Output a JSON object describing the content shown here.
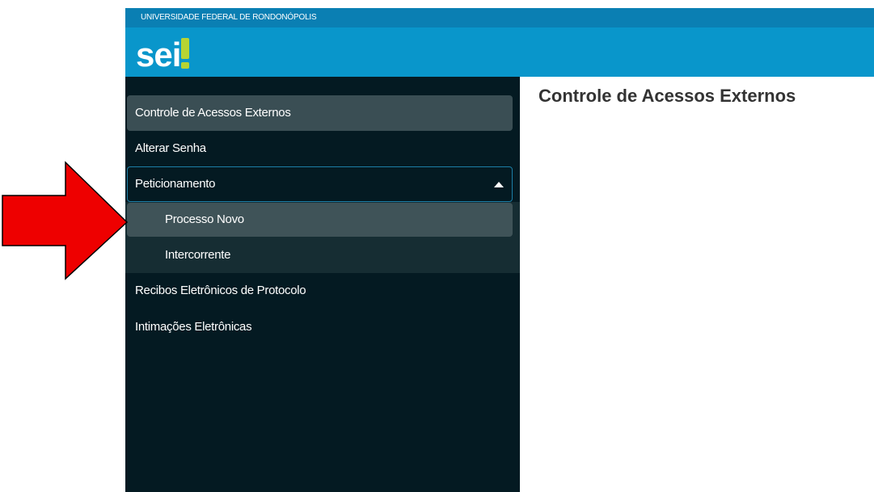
{
  "header": {
    "institution": "UNIVERSIDADE FEDERAL DE RONDONÓPOLIS",
    "logo_text": "sei"
  },
  "sidebar": {
    "items": [
      {
        "label": "Controle de Acessos Externos",
        "state": "active"
      },
      {
        "label": "Alterar Senha"
      },
      {
        "label": "Peticionamento",
        "state": "expanded"
      },
      {
        "label": "Recibos Eletrônicos de Protocolo"
      },
      {
        "label": "Intimações Eletrônicas"
      }
    ],
    "submenu": [
      {
        "label": "Processo Novo",
        "state": "highlighted"
      },
      {
        "label": "Intercorrente"
      }
    ]
  },
  "main": {
    "title": "Controle de Acessos Externos"
  },
  "annotation": {
    "arrow_color": "#ee0000",
    "arrow_icon": "arrow-right-icon"
  },
  "colors": {
    "header_bg": "#0996cb",
    "topbar_bg": "#0a7fb3",
    "sidebar_bg": "#041a22",
    "logo_accent": "#b7d433"
  }
}
